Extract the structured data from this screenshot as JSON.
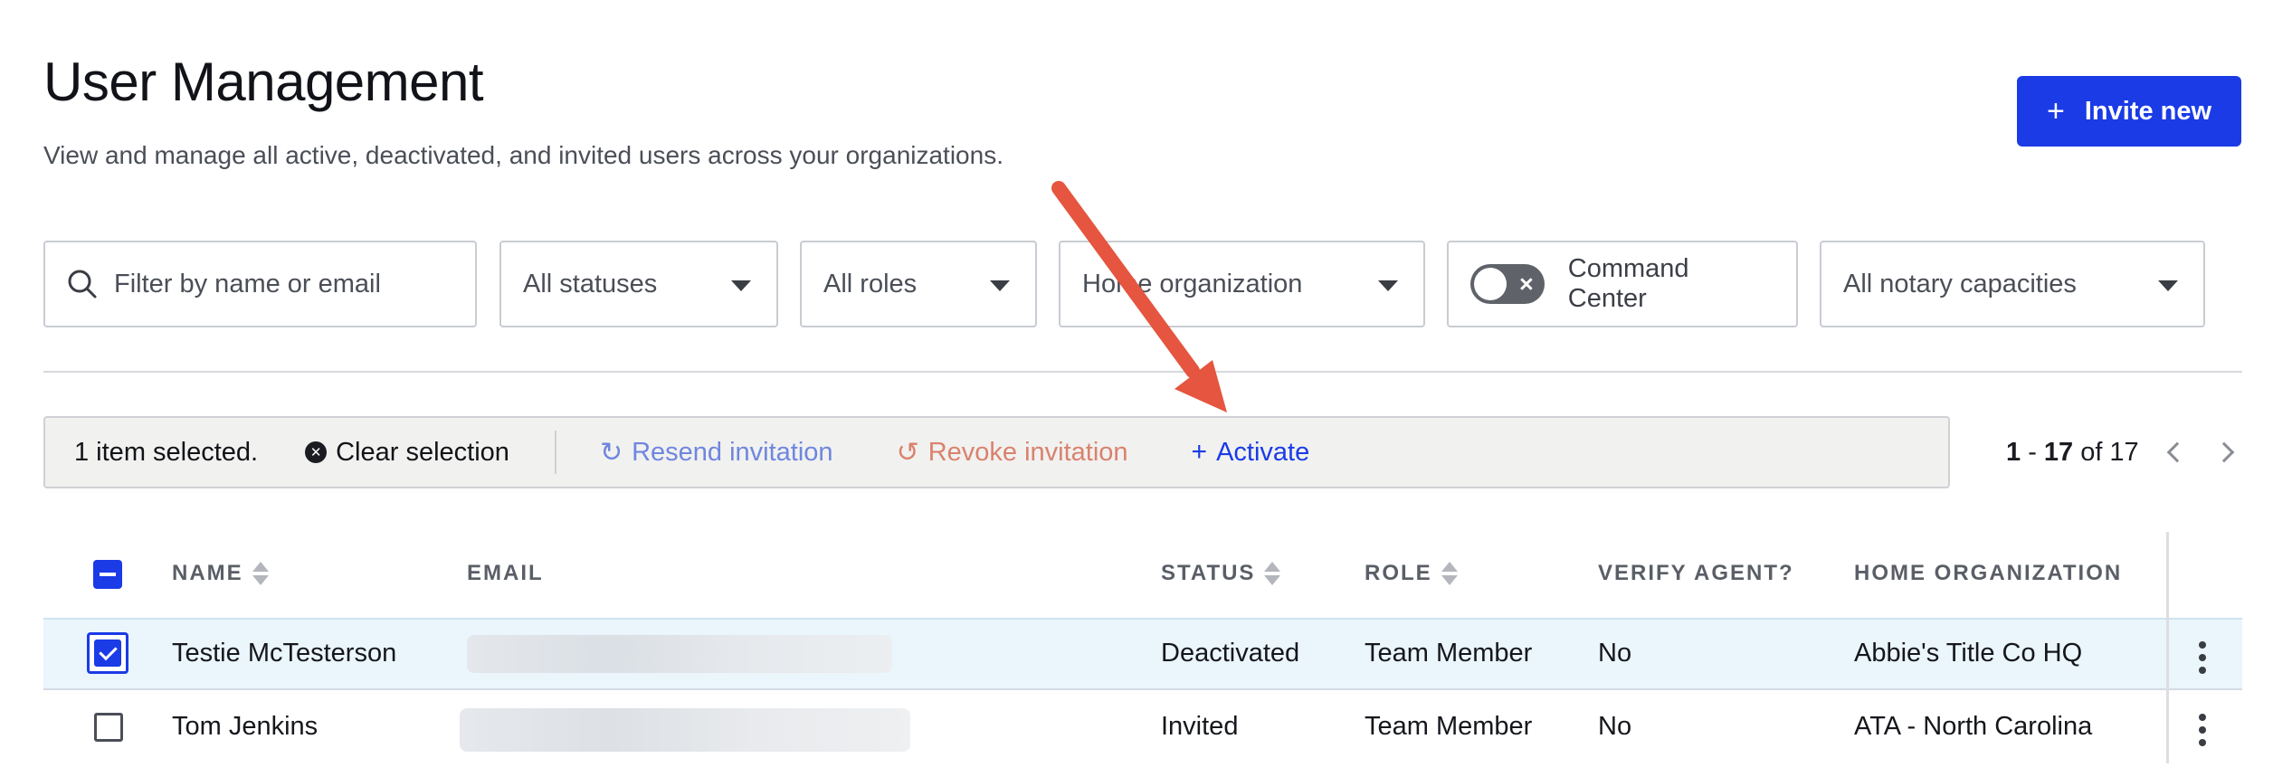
{
  "header": {
    "title": "User Management",
    "subtitle": "View and manage all active, deactivated, and invited users across your organizations.",
    "invite_label": "Invite new"
  },
  "filters": {
    "search_placeholder": "Filter by name or email",
    "status": "All statuses",
    "roles": "All roles",
    "organization": "Home organization",
    "command_center": "Command Center",
    "notary": "All notary capacities"
  },
  "bulk_bar": {
    "selected_text": "1 item selected.",
    "clear_label": "Clear selection",
    "resend_label": "Resend invitation",
    "revoke_label": "Revoke invitation",
    "activate_label": "Activate"
  },
  "pagination": {
    "start": "1",
    "end": "17",
    "of_text": "of 17"
  },
  "table": {
    "columns": [
      "NAME",
      "EMAIL",
      "STATUS",
      "ROLE",
      "VERIFY AGENT?",
      "HOME ORGANIZATION"
    ],
    "rows": [
      {
        "name": "Testie McTesterson",
        "status": "Deactivated",
        "role": "Team Member",
        "verify": "No",
        "org": "Abbie's Title Co HQ"
      },
      {
        "name": "Tom Jenkins",
        "status": "Invited",
        "role": "Team Member",
        "verify": "No",
        "org": "ATA - North Carolina"
      }
    ]
  },
  "colors": {
    "primary": "#1a3be6",
    "annotation_arrow": "#e5553f",
    "selected_row": "#eaf5fc"
  },
  "icons": [
    "search-icon",
    "caret-down-icon",
    "toggle-off-icon",
    "close-circle-icon",
    "refresh-icon",
    "undo-icon",
    "plus-icon",
    "chevron-left-icon",
    "chevron-right-icon",
    "sort-icon",
    "kebab-icon"
  ]
}
